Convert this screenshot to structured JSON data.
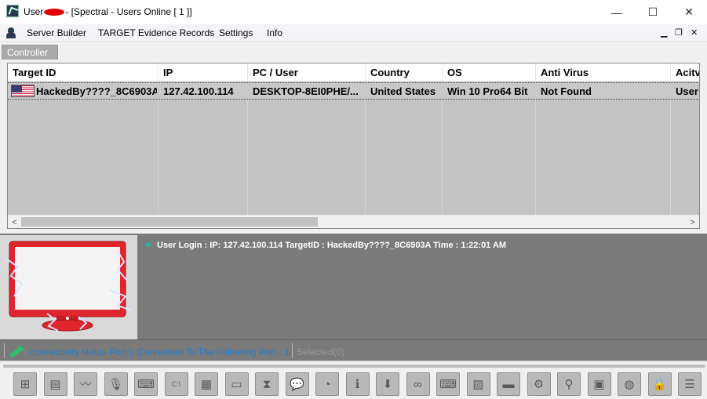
{
  "window": {
    "title_prefix": "User",
    "title_suffix": "- [Spectral - Users Online [ 1 ]]",
    "minimize": "—",
    "maximize": "☐",
    "close": "✕"
  },
  "menu": {
    "items": [
      "Server Builder",
      "TARGET Evidence Records",
      "Settings",
      "Info"
    ],
    "mdi_minimize": "▁",
    "mdi_restore": "❐",
    "mdi_close": "✕"
  },
  "tabs": [
    "Controller"
  ],
  "grid": {
    "columns": [
      "Target ID",
      "IP",
      "PC / User",
      "Country",
      "OS",
      "Anti Virus",
      "Acitv"
    ],
    "rows": [
      {
        "flag": "us-flag-icon",
        "target_id": "HackedBy????_8C6903A",
        "ip": "127.42.100.114",
        "pc_user": "DESKTOP-8EI0PHE/...",
        "country": "United States",
        "os": "Win 10 Pro64 Bit",
        "anti_virus": "Not Found",
        "activity": "User"
      }
    ],
    "scroll_left": "<",
    "scroll_right": ">"
  },
  "log": {
    "entries": [
      "User Login : IP: 127.42.100.114 TargetID : HackedBy????_8C6903A Time : 1:22:01 AM"
    ]
  },
  "status": {
    "connectivity": "connectivity status Port |- Connected To The Following Port : 1",
    "selected": "Selected(0)"
  },
  "toolbar": {
    "buttons": [
      {
        "name": "windows-icon",
        "glyph": "⊞"
      },
      {
        "name": "server-icon",
        "glyph": "▤"
      },
      {
        "name": "performance-monitor-icon",
        "glyph": "〰"
      },
      {
        "name": "microphone-icon",
        "glyph": "🎙"
      },
      {
        "name": "keyboard-icon",
        "glyph": "⌨"
      },
      {
        "name": "command-prompt-icon",
        "glyph": "C:\\"
      },
      {
        "name": "network-icon",
        "glyph": "▦"
      },
      {
        "name": "remote-desktop-icon",
        "glyph": "▭"
      },
      {
        "name": "hourglass-icon",
        "glyph": "⧗"
      },
      {
        "name": "chat-icon",
        "glyph": "💬"
      },
      {
        "name": "spy-icon",
        "glyph": "◔"
      },
      {
        "name": "information-icon",
        "glyph": "ℹ"
      },
      {
        "name": "download-icon",
        "glyph": "⬇"
      },
      {
        "name": "link-icon",
        "glyph": "∞"
      },
      {
        "name": "remote-screen-icon",
        "glyph": "⌨"
      },
      {
        "name": "image-icon",
        "glyph": "▨"
      },
      {
        "name": "display-icon",
        "glyph": "▬"
      },
      {
        "name": "user-settings-icon",
        "glyph": "⚙"
      },
      {
        "name": "pin-icon",
        "glyph": "⚲"
      },
      {
        "name": "chip-icon",
        "glyph": "▣"
      },
      {
        "name": "globe-icon",
        "glyph": "◍"
      },
      {
        "name": "lock-icon",
        "glyph": "🔒"
      },
      {
        "name": "database-icon",
        "glyph": "☰"
      }
    ]
  },
  "colors": {
    "status_text": "#1f7ed6",
    "log_dot": "#25b6a8",
    "monitor_red": "#e0262c",
    "lightning": "#c9d9ff"
  }
}
